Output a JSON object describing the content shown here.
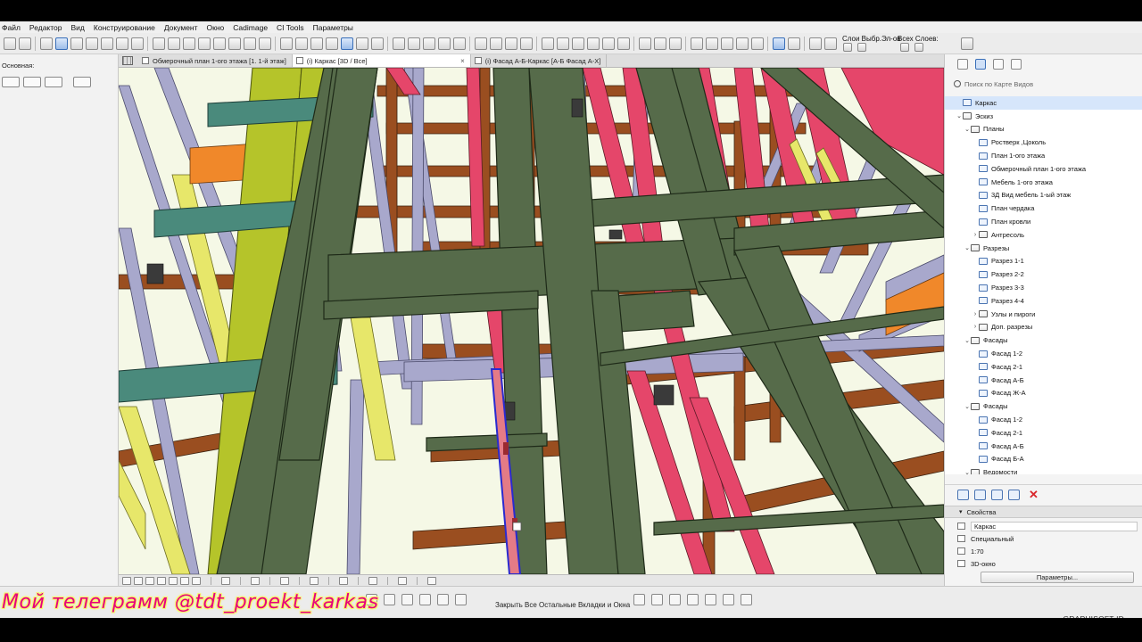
{
  "menu": [
    "Файл",
    "Редактор",
    "Вид",
    "Конструирование",
    "Документ",
    "Окно",
    "Cadimage",
    "CI Tools",
    "Параметры"
  ],
  "toolbar": {
    "layers_label": "Слои Выбр.Эл-ов",
    "all_layers_label": "Всех Слоев:"
  },
  "left_panel": {
    "label": "Основная:"
  },
  "tabs": [
    {
      "label": "Обмерочный план 1-ого этажа [1. 1-й этаж]",
      "active": false
    },
    {
      "label": "(i) Каркас [3D / Все]",
      "active": true
    },
    {
      "label": "(i) Фасад А-Б-Каркас [А-Б Фасад А-Х]",
      "active": false
    }
  ],
  "view_map": {
    "search_placeholder": "Поиск по Карте Видов",
    "tree": [
      {
        "label": "Каркас",
        "level": 1,
        "arrow": "",
        "icon": "view",
        "selected": true
      },
      {
        "label": "Эскиз",
        "level": 1,
        "arrow": "v",
        "icon": "folder"
      },
      {
        "label": "Планы",
        "level": 2,
        "arrow": "v",
        "icon": "folder"
      },
      {
        "label": "Ростверк ,Цоколь",
        "level": 3,
        "arrow": "",
        "icon": "view"
      },
      {
        "label": "План 1-ого этажа",
        "level": 3,
        "arrow": "",
        "icon": "view"
      },
      {
        "label": "Обмерочный план 1-ого этажа",
        "level": 3,
        "arrow": "",
        "icon": "view"
      },
      {
        "label": "Мебель 1-ого этажа",
        "level": 3,
        "arrow": "",
        "icon": "view"
      },
      {
        "label": "3Д Вид мебель  1-ый этаж",
        "level": 3,
        "arrow": "",
        "icon": "view"
      },
      {
        "label": "План чердака",
        "level": 3,
        "arrow": "",
        "icon": "view"
      },
      {
        "label": "План кровли",
        "level": 3,
        "arrow": "",
        "icon": "view"
      },
      {
        "label": "Антресоль",
        "level": 3,
        "arrow": ">",
        "icon": "folder"
      },
      {
        "label": "Разрезы",
        "level": 2,
        "arrow": "v",
        "icon": "folder"
      },
      {
        "label": "Разрез 1-1",
        "level": 3,
        "arrow": "",
        "icon": "view"
      },
      {
        "label": "Разрез 2-2",
        "level": 3,
        "arrow": "",
        "icon": "view"
      },
      {
        "label": "Разрез 3-3",
        "level": 3,
        "arrow": "",
        "icon": "view"
      },
      {
        "label": "Разрез 4-4",
        "level": 3,
        "arrow": "",
        "icon": "view"
      },
      {
        "label": "Узлы и пироги",
        "level": 3,
        "arrow": ">",
        "icon": "folder"
      },
      {
        "label": "Доп. разрезы",
        "level": 3,
        "arrow": ">",
        "icon": "folder"
      },
      {
        "label": "Фасады",
        "level": 2,
        "arrow": "v",
        "icon": "folder"
      },
      {
        "label": "Фасад 1-2",
        "level": 3,
        "arrow": "",
        "icon": "view"
      },
      {
        "label": "Фасад 2-1",
        "level": 3,
        "arrow": "",
        "icon": "view"
      },
      {
        "label": "Фасад А-Б",
        "level": 3,
        "arrow": "",
        "icon": "view"
      },
      {
        "label": "Фасад Ж-А",
        "level": 3,
        "arrow": "",
        "icon": "view"
      },
      {
        "label": "Фасады",
        "level": 2,
        "arrow": "v",
        "icon": "folder"
      },
      {
        "label": "Фасад 1-2",
        "level": 3,
        "arrow": "",
        "icon": "view"
      },
      {
        "label": "Фасад 2-1",
        "level": 3,
        "arrow": "",
        "icon": "view"
      },
      {
        "label": "Фасад А-Б",
        "level": 3,
        "arrow": "",
        "icon": "view"
      },
      {
        "label": "Фасад Б-А",
        "level": 3,
        "arrow": "",
        "icon": "view"
      },
      {
        "label": "Ведомости",
        "level": 2,
        "arrow": "v",
        "icon": "folder"
      }
    ]
  },
  "properties": {
    "header": "Свойства",
    "name": "Каркас",
    "category": "Специальный",
    "scale": "1:70",
    "view_type": "3D-окно",
    "params_button": "Параметры..."
  },
  "status_hint": "Закрыть Все Остальные Вкладки и Окна",
  "branding": "GRAPHISOFT ID",
  "watermark": "Мой телеграмм @tdt_proekt_karkas",
  "colors": {
    "olive_beam": "#566b4a",
    "brown_joist": "#9a4e20",
    "red_post": "#e5466a",
    "lavender_frame": "#a8a8cc",
    "yellow_member": "#e7e76a",
    "teal_beam": "#4a8a7c",
    "selection_blue": "#2a2ad0"
  }
}
